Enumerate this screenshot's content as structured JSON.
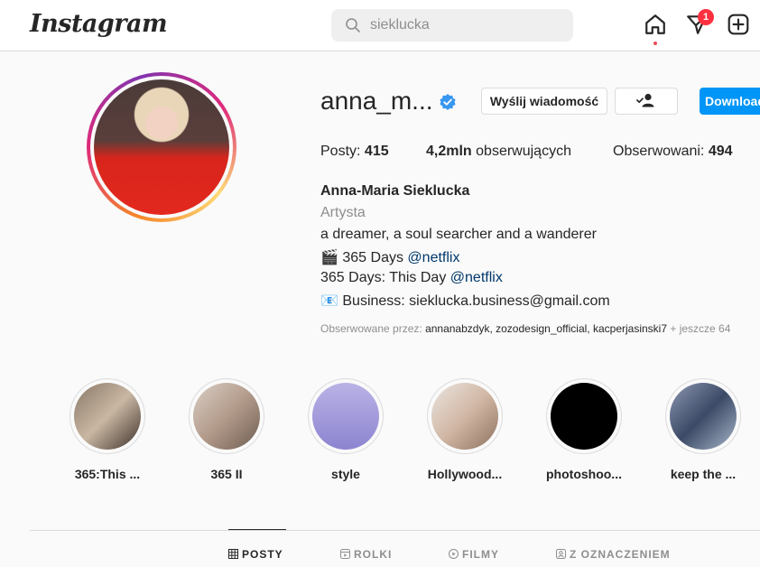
{
  "nav": {
    "logo": "Instagram",
    "search_value": "sieklucka",
    "activity_badge": "1"
  },
  "profile": {
    "username": "anna_m...",
    "verified": true,
    "message_button": "Wyślij wiadomość",
    "download_button": "Download",
    "stats": {
      "posts_label": "Posty:",
      "posts_value": "415",
      "followers_value": "4,2mln",
      "followers_label": "obserwujących",
      "following_label": "Obserwowani:",
      "following_value": "494"
    },
    "bio": {
      "name": "Anna-Maria Sieklucka",
      "category": "Artysta",
      "line1": "a dreamer, a soul searcher and a wanderer",
      "line2_text": "🎬 365 Days",
      "line2_link": "@netflix",
      "line3_text": "365 Days: This Day",
      "line3_link": "@netflix",
      "line4": "📧 Business: sieklucka.business@gmail.com"
    },
    "followed_by": {
      "prefix": "Obserwowane przez:",
      "names": "annanabzdyk, zozodesign_official, kacperjasinski7",
      "suffix": "+ jeszcze 64"
    }
  },
  "highlights": [
    {
      "label": "365:This ..."
    },
    {
      "label": "365 II"
    },
    {
      "label": "style"
    },
    {
      "label": "Hollywood..."
    },
    {
      "label": "photoshoo..."
    },
    {
      "label": "keep the ..."
    }
  ],
  "tabs": [
    {
      "label": "POSTY",
      "active": true
    },
    {
      "label": "ROLKI",
      "active": false
    },
    {
      "label": "FILMY",
      "active": false
    },
    {
      "label": "Z OZNACZENIEM",
      "active": false
    }
  ],
  "colors": {
    "accent": "#0095f6",
    "verified": "#3897f0",
    "badge": "#ff3040",
    "link": "#00376b"
  }
}
